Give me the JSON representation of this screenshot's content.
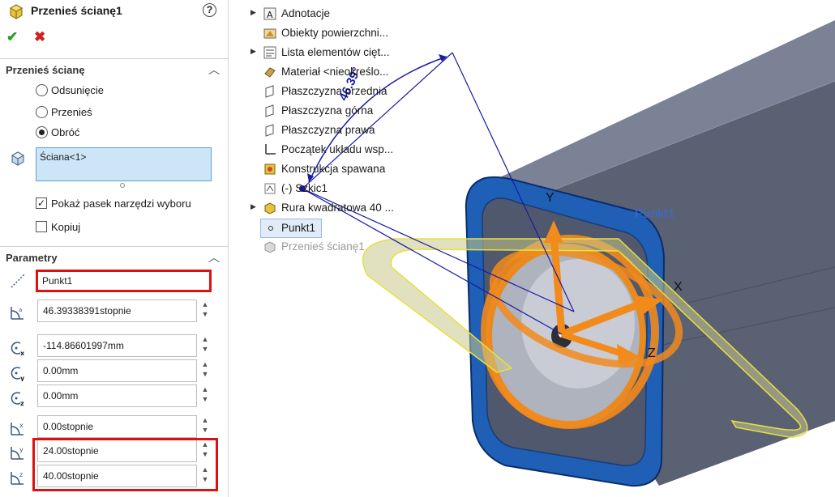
{
  "panel": {
    "title": "Przenieś ścianę1",
    "help_icon": "question-circle-icon",
    "ok_icon": "check-icon",
    "cancel_icon": "close-icon",
    "section1": {
      "label": "Przenieś ścianę",
      "options": [
        "Odsunięcie",
        "Przenieś",
        "Obróć"
      ],
      "selected": "Obróć",
      "selection_box": "Ściana<1>",
      "show_toolbar_label": "Pokaż pasek narzędzi wyboru",
      "show_toolbar_checked": true,
      "copy_label": "Kopiuj",
      "copy_checked": false
    },
    "section2": {
      "label": "Parametry",
      "axis_field": "Punkt1",
      "angle": "46.39338391stopnie",
      "x": "-114.86601997mm",
      "y": "0.00mm",
      "z": "0.00mm",
      "rot_x": "0.00stopnie",
      "rot_y": "24.00stopnie",
      "rot_z": "40.00stopnie"
    }
  },
  "tree": {
    "items": [
      {
        "label": "Adnotacje",
        "icon": "annotation-icon",
        "expandable": true
      },
      {
        "label": "Obiekty powierzchni...",
        "icon": "surface-bodies-icon",
        "expandable": false
      },
      {
        "label": "Lista elementów cięt...",
        "icon": "cut-list-icon",
        "expandable": true
      },
      {
        "label": "Materiał <nieokreślo...",
        "icon": "material-icon",
        "expandable": false
      },
      {
        "label": "Płaszczyzna przednia",
        "icon": "plane-icon",
        "expandable": false
      },
      {
        "label": "Płaszczyzna górna",
        "icon": "plane-icon",
        "expandable": false
      },
      {
        "label": "Płaszczyzna prawa",
        "icon": "plane-icon",
        "expandable": false
      },
      {
        "label": "Początek układu wsp...",
        "icon": "origin-icon",
        "expandable": false
      },
      {
        "label": "Konstrukcja spawana",
        "icon": "weldment-icon",
        "expandable": false
      },
      {
        "label": "(-) Szkic1",
        "icon": "sketch-icon",
        "expandable": false
      },
      {
        "label": "Rura kwadratowa 40 ...",
        "icon": "structural-member-icon",
        "expandable": true
      },
      {
        "label": "Punkt1",
        "icon": "point-icon",
        "expandable": false
      },
      {
        "label": "Przenieś ścianę1",
        "icon": "move-face-icon",
        "expandable": false
      }
    ]
  },
  "viewport": {
    "dimension_label": "46.39°",
    "point_label": "Punkt1",
    "axis_y": "Y",
    "axis_x": "X",
    "axis_z": "Z"
  },
  "colors": {
    "accent_red": "#e01010",
    "face_blue": "#1f5fb5",
    "triad_orange": "#f28a1c",
    "selection_blue": "#cde6f7"
  }
}
